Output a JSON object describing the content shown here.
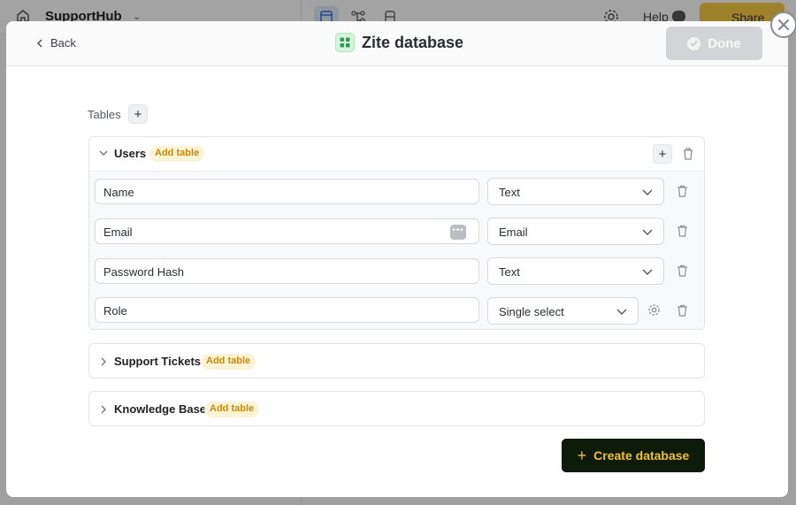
{
  "background": {
    "app_title": "SupportHub",
    "help_label": "Help",
    "share_label": "Share"
  },
  "header": {
    "back_label": "Back",
    "title": "Zite database",
    "done_label": "Done"
  },
  "tables_label": "Tables",
  "tables": [
    {
      "name": "Users",
      "badge": "Add table",
      "expanded": true,
      "fields": [
        {
          "name": "Name",
          "type": "Text"
        },
        {
          "name": "Email",
          "type": "Email"
        },
        {
          "name": "Password Hash",
          "type": "Text"
        },
        {
          "name": "Role",
          "type": "Single select"
        }
      ]
    },
    {
      "name": "Support Tickets",
      "badge": "Add table",
      "expanded": false
    },
    {
      "name": "Knowledge Base",
      "badge": "Add table",
      "expanded": false
    }
  ],
  "create_label": "Create database",
  "colors": {
    "accent_yellow": "#f2c230",
    "badge_text": "#c78a0a",
    "badge_bg": "#fdf3d7",
    "create_bg": "#0e1a0a",
    "done_bg": "#d2d4d7"
  }
}
